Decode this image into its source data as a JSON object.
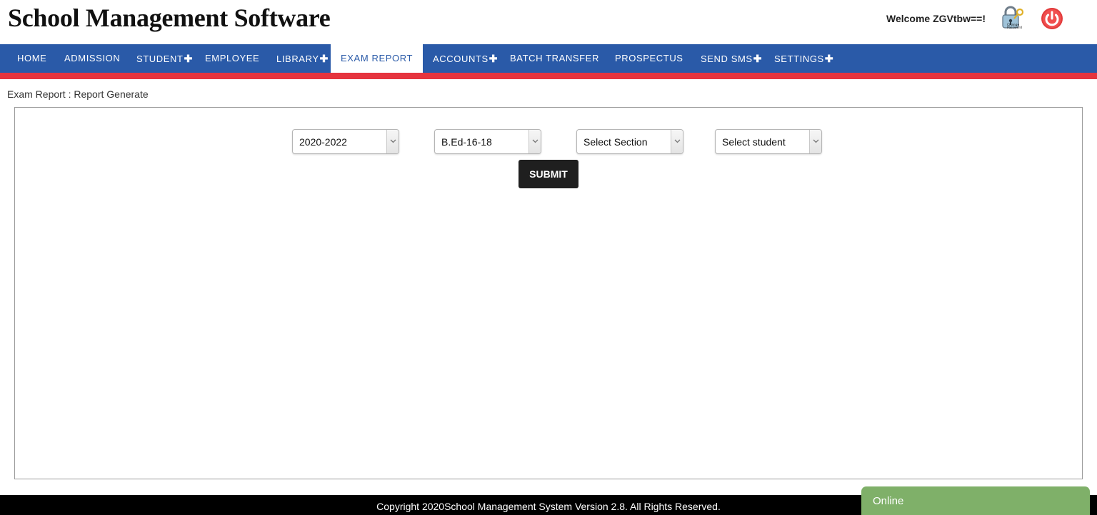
{
  "header": {
    "title": "School Management Software",
    "welcome": "Welcome ZGVtbw==!",
    "change_password_icon": "padlock-key-icon",
    "logout_icon": "power-icon"
  },
  "nav": {
    "items": [
      {
        "label": "HOME",
        "has_submenu": false
      },
      {
        "label": "ADMISSION",
        "has_submenu": false
      },
      {
        "label": "STUDENT",
        "has_submenu": true
      },
      {
        "label": "EMPLOYEE",
        "has_submenu": false
      },
      {
        "label": "LIBRARY",
        "has_submenu": true
      },
      {
        "label": "EXAM REPORT",
        "has_submenu": false,
        "active": true
      },
      {
        "label": "ACCOUNTS",
        "has_submenu": true
      },
      {
        "label": "BATCH TRANSFER",
        "has_submenu": false
      },
      {
        "label": "PROSPECTUS",
        "has_submenu": false
      },
      {
        "label": "SEND SMS",
        "has_submenu": true
      },
      {
        "label": "SETTINGS",
        "has_submenu": true
      }
    ],
    "plus_symbol": "✚"
  },
  "breadcrumb": "Exam Report : Report Generate",
  "form": {
    "session": "2020-2022",
    "course": "B.Ed-16-18",
    "section": "Select Section",
    "student": "Select student",
    "submit_label": "SUBMIT"
  },
  "footer": {
    "copyright": "Copyright 2020School Management System Version 2.8. All Rights Reserved."
  },
  "chat": {
    "status": "Online"
  },
  "colors": {
    "nav_bg": "#2a5aa8",
    "nav_accent": "#e5343e",
    "chat_bg": "#7fb069"
  }
}
